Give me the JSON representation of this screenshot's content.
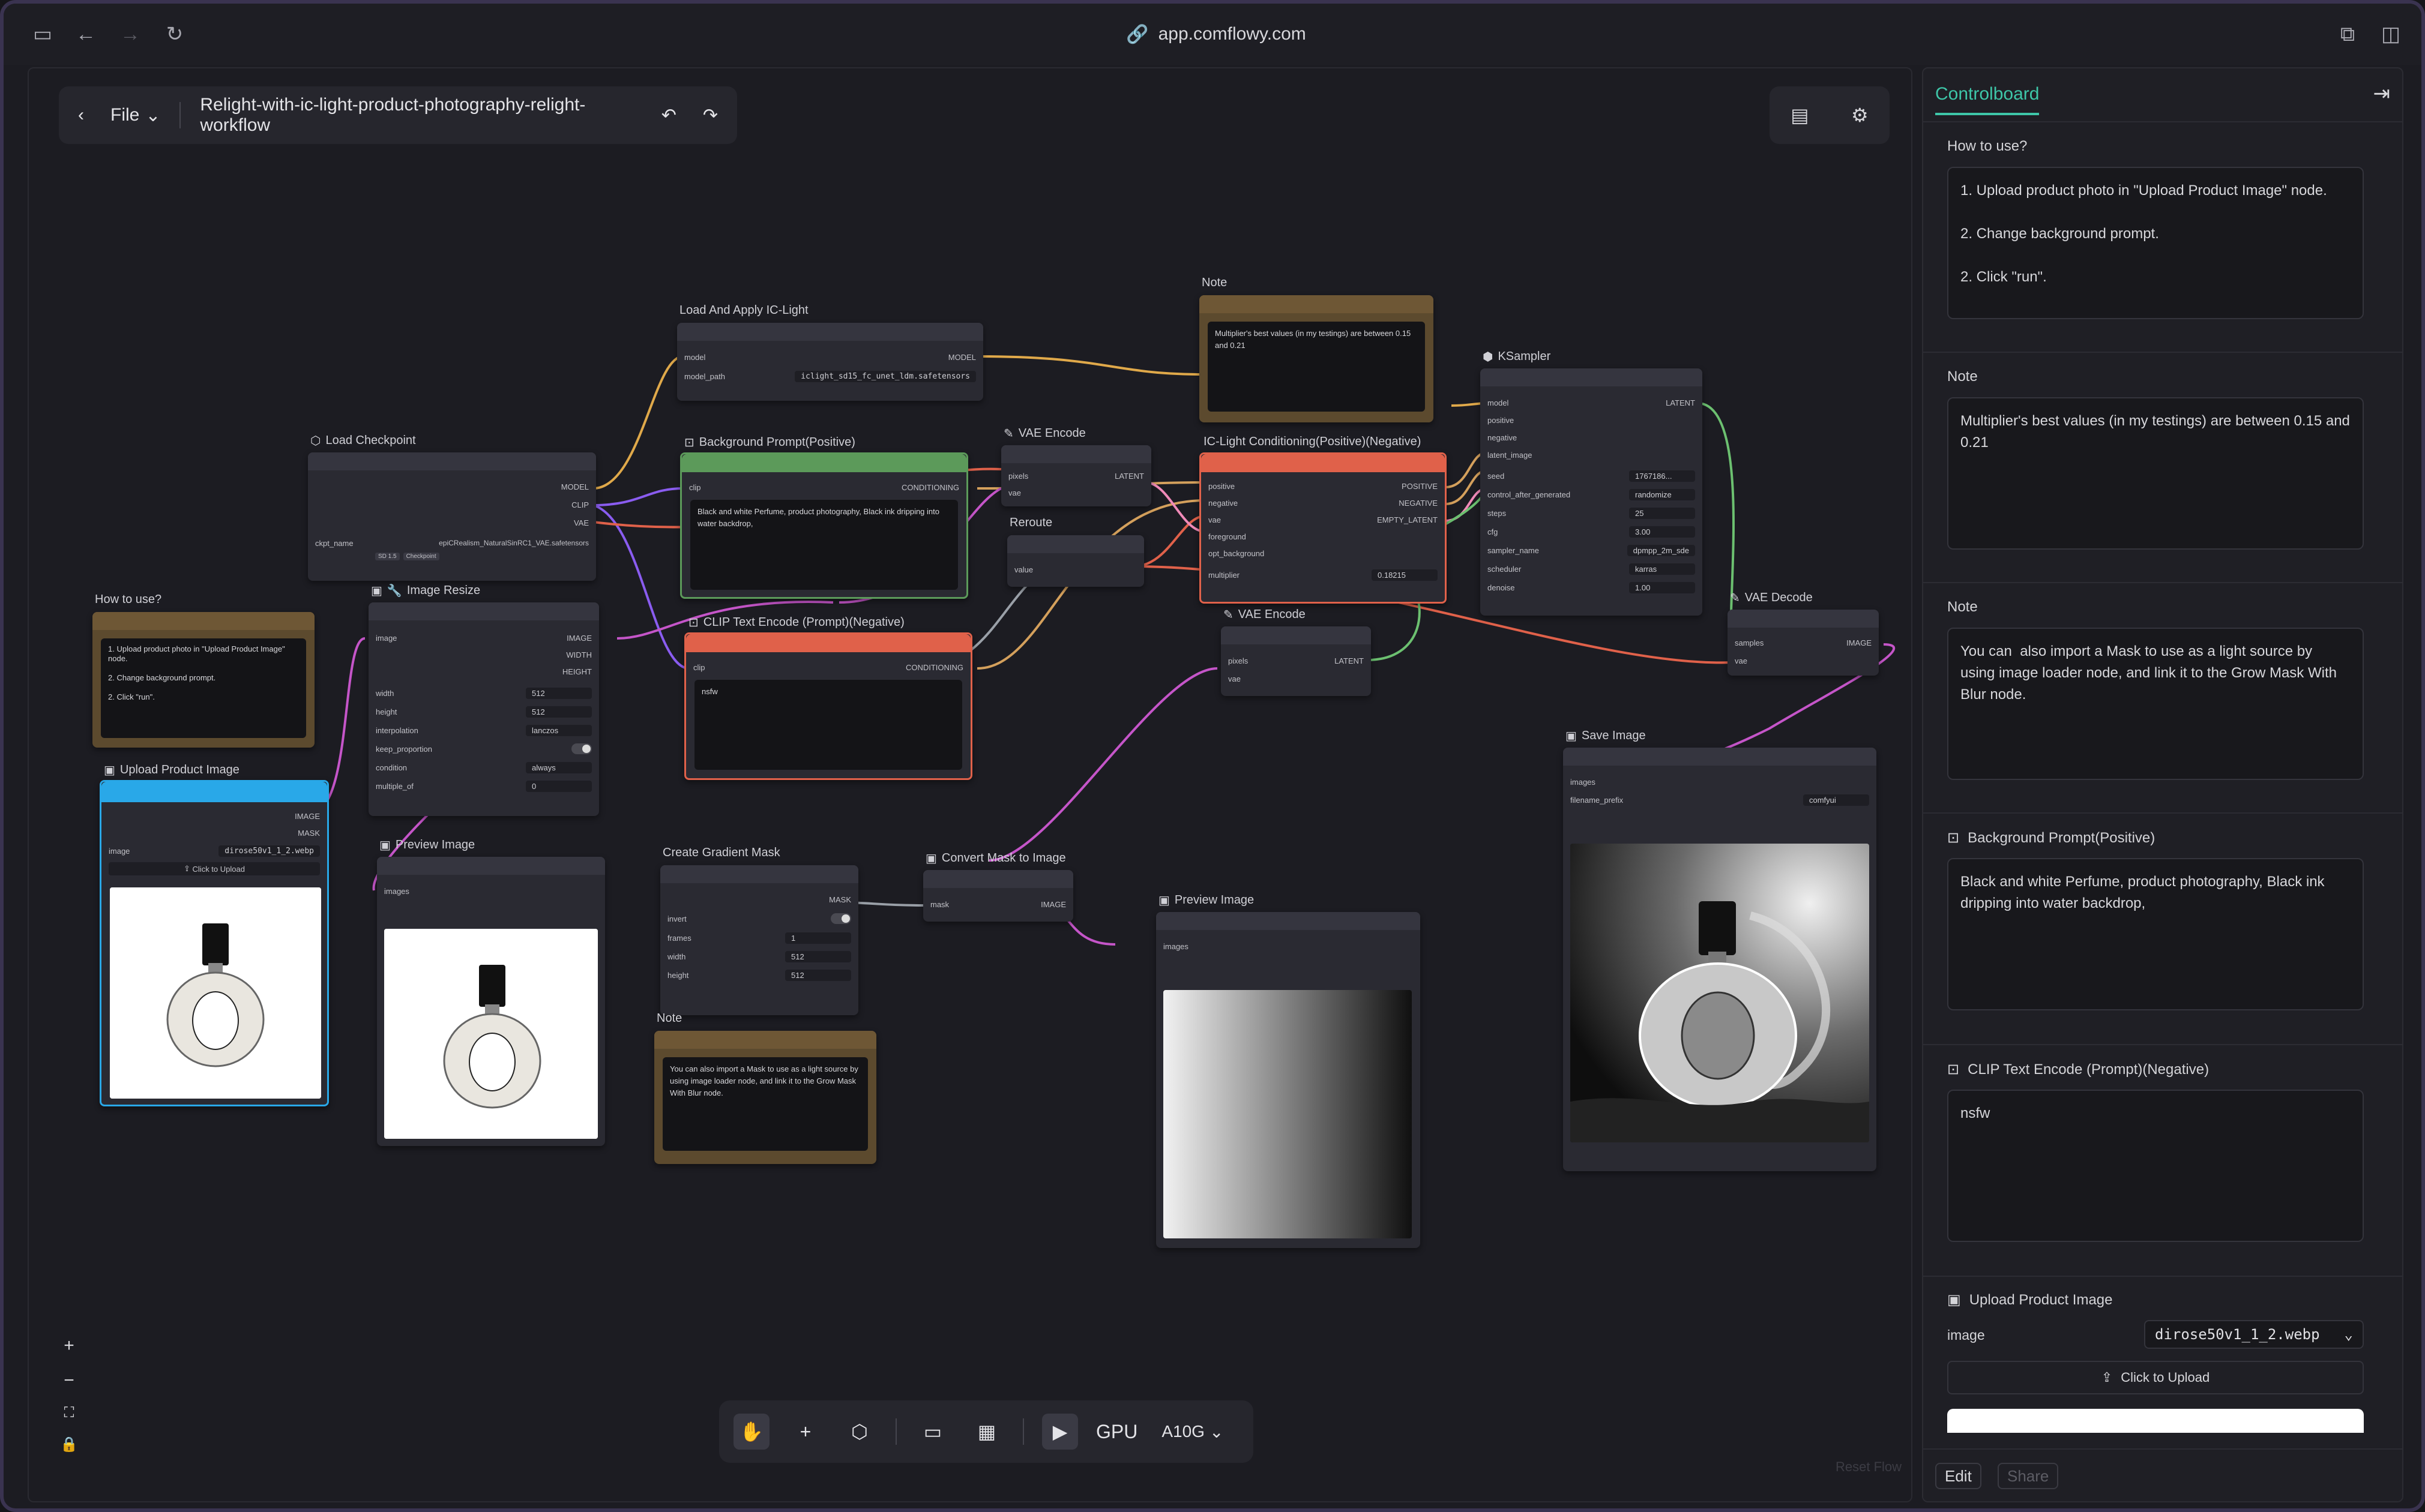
{
  "browser": {
    "url": "app.comflowy.com"
  },
  "topbar": {
    "file_label": "File",
    "workflow_title": "Relight-with-ic-light-product-photography-relight-workflow"
  },
  "nodes": {
    "load_ic_light": {
      "title": "Load And Apply IC-Light",
      "in_model": "model",
      "out_model": "MODEL",
      "model_path_label": "model_path",
      "model_path_value": "iclight_sd15_fc_unet_ldm.safetensors"
    },
    "note_top": {
      "title": "Note",
      "text": "Multiplier's best values (in my testings) are between 0.15 and 0.21"
    },
    "ksampler": {
      "title": "KSampler",
      "in": [
        "model",
        "positive",
        "negative",
        "latent_image"
      ],
      "out": "LATENT",
      "params": [
        {
          "k": "seed",
          "v": "1767186..."
        },
        {
          "k": "control_after_generated",
          "v": "randomize"
        },
        {
          "k": "steps",
          "v": "25"
        },
        {
          "k": "cfg",
          "v": "3.00"
        },
        {
          "k": "sampler_name",
          "v": "dpmpp_2m_sde"
        },
        {
          "k": "scheduler",
          "v": "karras"
        },
        {
          "k": "denoise",
          "v": "1.00"
        }
      ]
    },
    "load_checkpoint": {
      "title": "Load Checkpoint",
      "outs": [
        "MODEL",
        "CLIP",
        "VAE"
      ],
      "ckpt_label": "ckpt_name",
      "ckpt_value": "epiCRealism_NaturalSinRC1_VAE.safetensors",
      "tag1": "SD 1.5",
      "tag2": "Checkpoint"
    },
    "bg_prompt": {
      "title": "Background Prompt(Positive)",
      "in": "clip",
      "out": "CONDITIONING",
      "text": "Black and white Perfume, product photography, Black ink dripping into water backdrop,"
    },
    "vae_encode_top": {
      "title": "VAE Encode",
      "in": [
        "pixels",
        "vae"
      ],
      "out": "LATENT"
    },
    "reroute": {
      "title": "Reroute",
      "in": "value"
    },
    "ic_cond": {
      "title": "IC-Light Conditioning(Positive)(Negative)",
      "in": [
        "positive",
        "negative",
        "vae",
        "foreground",
        "opt_background"
      ],
      "outs": [
        "POSITIVE",
        "NEGATIVE",
        "EMPTY_LATENT"
      ],
      "multiplier_label": "multiplier",
      "multiplier_value": "0.18215"
    },
    "vae_decode": {
      "title": "VAE Decode",
      "in": [
        "samples",
        "vae"
      ],
      "out": "IMAGE"
    },
    "how_to_use": {
      "title": "How to use?",
      "text": "1. Upload product photo in \"Upload Product Image\" node.\n\n2. Change background prompt.\n\n2. Click \"run\"."
    },
    "image_resize": {
      "title": "Image Resize",
      "in": "image",
      "outs": [
        "IMAGE",
        "WIDTH",
        "HEIGHT"
      ],
      "params": [
        {
          "k": "width",
          "v": "512"
        },
        {
          "k": "height",
          "v": "512"
        },
        {
          "k": "interpolation",
          "v": "lanczos"
        },
        {
          "k": "keep_proportion",
          "v": ""
        },
        {
          "k": "condition",
          "v": "always"
        },
        {
          "k": "multiple_of",
          "v": "0"
        }
      ]
    },
    "clip_neg": {
      "title": "CLIP Text Encode (Prompt)(Negative)",
      "in": "clip",
      "out": "CONDITIONING",
      "text": "nsfw"
    },
    "vae_encode_mid": {
      "title": "VAE Encode",
      "in": [
        "pixels",
        "vae"
      ],
      "out": "LATENT"
    },
    "save_image": {
      "title": "Save Image",
      "in": "images",
      "prefix_label": "filename_prefix",
      "prefix_value": "comfyui"
    },
    "upload_product": {
      "title": "Upload Product Image",
      "outs": [
        "IMAGE",
        "MASK"
      ],
      "image_label": "image",
      "image_value": "dirose50v1_1_2.webp",
      "upload_label": "Click to Upload"
    },
    "preview1": {
      "title": "Preview Image",
      "in": "images"
    },
    "gradient_mask": {
      "title": "Create Gradient Mask",
      "out": "MASK",
      "params": [
        {
          "k": "invert",
          "v": ""
        },
        {
          "k": "frames",
          "v": "1"
        },
        {
          "k": "width",
          "v": "512"
        },
        {
          "k": "height",
          "v": "512"
        }
      ]
    },
    "convert_mask": {
      "title": "Convert Mask to Image",
      "in": "mask",
      "out": "IMAGE"
    },
    "preview2": {
      "title": "Preview Image",
      "in": "images"
    },
    "note_bottom": {
      "title": "Note",
      "text": "You can  also import a Mask to use as a light source by using image loader node, and link it to the Grow Mask With Blur node."
    }
  },
  "toolbar": {
    "gpu_label": "GPU",
    "gpu_value": "A10G"
  },
  "canvas": {
    "reset_label": "Reset Flow"
  },
  "controlboard": {
    "tab": "Controlboard",
    "sections": [
      {
        "label": "How to use?",
        "text": "1. Upload product photo in \"Upload Product Image\" node.\n\n2. Change background prompt.\n\n2. Click \"run\"."
      },
      {
        "label": "Note",
        "text": "Multiplier's best values (in my testings) are between 0.15 and 0.21"
      },
      {
        "label": "Note",
        "text": "You can  also import a Mask to use as a light source by using image loader node, and link it to the Grow Mask With Blur node."
      },
      {
        "label": "Background Prompt(Positive)",
        "text": "Black and white Perfume, product photography, Black ink dripping into water backdrop,"
      },
      {
        "label": "CLIP Text Encode (Prompt)(Negative)",
        "text": "nsfw"
      }
    ],
    "upload": {
      "label": "Upload Product Image",
      "image_label": "image",
      "image_value": "dirose50v1_1_2.webp",
      "upload_label": "Click to Upload"
    },
    "edit_label": "Edit",
    "share_label": "Share"
  },
  "colors": {
    "accent": "#3ec6a8",
    "positive_node": "#5c9a5a",
    "negative_node": "#e0614a",
    "upload_node": "#29a8e8",
    "note_bg": "#5c4a2e"
  }
}
